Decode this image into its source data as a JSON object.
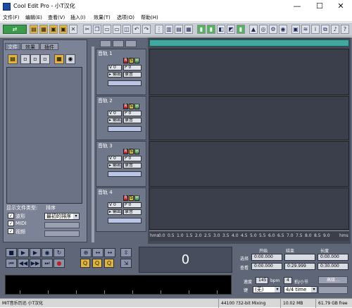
{
  "window": {
    "title": "Cool Edit Pro  - 小T汉化",
    "minimize": "—",
    "maximize": "☐",
    "close": "✕"
  },
  "menu": [
    "文件(F)",
    "编辑(E)",
    "查看(V)",
    "插入(I)",
    "效果(T)",
    "选项(O)",
    "帮助(H)"
  ],
  "file_panel": {
    "tabs": [
      "文件",
      "效果",
      "插件"
    ],
    "sort_label": "显示文件类型:",
    "sort_by_label": "排序",
    "checkboxes": [
      "波形",
      "MIDI",
      "视频"
    ],
    "sort_value": "最初的排序"
  },
  "tracks": [
    {
      "name": "音轨 1",
      "vol": "V 0",
      "pan": "P 0",
      "out": "▸ 输出",
      "in": "录音"
    },
    {
      "name": "音轨 2",
      "vol": "V 0",
      "pan": "P 0",
      "out": "▸ 输出",
      "in": "录音"
    },
    {
      "name": "音轨 3",
      "vol": "V 0",
      "pan": "P 0",
      "out": "▸ 输出",
      "in": "录音"
    },
    {
      "name": "音轨 4",
      "vol": "V 0",
      "pan": "P 0",
      "out": "▸ 输出",
      "in": "录音"
    }
  ],
  "track_buttons": {
    "r": "R",
    "s": "S",
    "m": "M"
  },
  "ruler": [
    "hms",
    "0.0",
    "0.5",
    "1.0",
    "1.5",
    "2.0",
    "2.5",
    "3.0",
    "3.5",
    "4.0",
    "4.5",
    "5.0",
    "5.5",
    "6.0",
    "6.5",
    "7.0",
    "7.5",
    "8.0",
    "8.5",
    "9.0",
    "hms"
  ],
  "transport": {
    "row1": [
      "■",
      "▶",
      "▶",
      "◉",
      "↻"
    ],
    "row2": [
      "⏮",
      "◀◀",
      "▶▶",
      "⏭",
      "●"
    ],
    "zoom_row1": [
      "⊕",
      "↔",
      "↔",
      "⇳"
    ],
    "zoom_row2": [
      "Q",
      "Q",
      "Q",
      "⇲"
    ]
  },
  "time_display": "0",
  "selection_info": {
    "col_begin": "开始",
    "col_end": "结束",
    "col_length": "长度",
    "row_selection": "选择",
    "row_view": "查看",
    "sel_begin": "0:00.000",
    "sel_end": "",
    "sel_length": "0:00.000",
    "view_begin": "0:00.000",
    "view_end": "0:29.999",
    "view_length": "0:30.000"
  },
  "tempo": {
    "label": "速度",
    "value": "145",
    "unit": "bpm",
    "beats": "4",
    "beats_label": "拍/小节",
    "key_label": "键",
    "key_value": "(无)",
    "mode_value": "4/4 time",
    "advanced": "高级..."
  },
  "status": {
    "left": "MIT音乐历迅 小T汉化",
    "sample": "44100 ?32-bit Mixing",
    "disk": "10.02 MB",
    "free": "61.79 GB free"
  }
}
